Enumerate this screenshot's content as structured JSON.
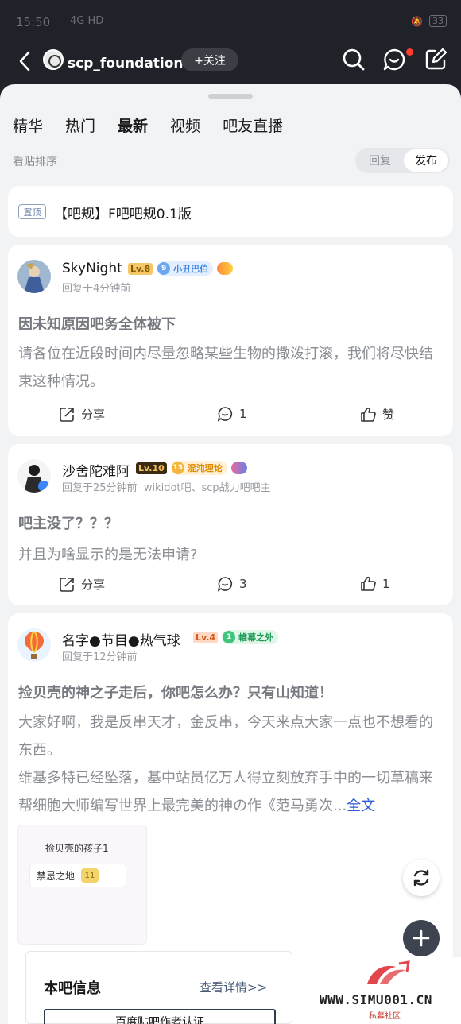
{
  "status": {
    "time": "15:50",
    "network": "4G HD",
    "battery": "33"
  },
  "forum": {
    "name": "scp_foundation吧",
    "follow_label": "+关注"
  },
  "tabs": [
    {
      "label": "精华",
      "active": false
    },
    {
      "label": "热门",
      "active": false
    },
    {
      "label": "最新",
      "active": true
    },
    {
      "label": "视频",
      "active": false
    },
    {
      "label": "吧友直播",
      "active": false
    }
  ],
  "sort": {
    "label": "看贴排序",
    "reply": "回复",
    "publish": "发布",
    "selected": "发布"
  },
  "pinned": {
    "badge": "置顶",
    "title": "【吧规】F吧吧规0.1版"
  },
  "posts": [
    {
      "username": "SkyNight",
      "level": "Lv.8",
      "fan_level": "9",
      "fan_title": "小丑巴伯",
      "meta": "回复于4分钟前",
      "title": "因未知原因吧务全体被下",
      "body": "请各位在近段时间内尽量忽略某些生物的撒泼打滚，我们将尽快结束这种情况。",
      "share_label": "分享",
      "comments": "1",
      "likes": "赞"
    },
    {
      "username": "沙舍陀难阿",
      "level": "Lv.10",
      "fan_level": "13",
      "fan_title": "混沌理论",
      "meta": "回复于25分钟前",
      "meta_extra": "wikidot吧、scp战力吧吧主",
      "title": "吧主没了？？？",
      "body": "并且为啥显示的是无法申请?",
      "share_label": "分享",
      "comments": "3",
      "likes": "1"
    },
    {
      "username": "名字●节目●热气球",
      "level": "Lv.4",
      "fan_level": "1",
      "fan_title": "帷幕之外",
      "meta": "回复于12分钟前",
      "title": "捡贝壳的神之子走后，你吧怎么办？只有山知道！",
      "body_line1": "大家好啊，我是反串天才，金反串，今天来点大家一点也不想看的东西。",
      "body_line2": "维基多特已经坠落，基中站员亿万人得立刻放弃手中的一切草稿来帮细胞大师编写世界上最完美的神の作《范马勇次...",
      "more": "全文",
      "thumb_title": "捡贝壳的孩子1",
      "thumb_chip": "禁忌之地",
      "thumb_chip_level": "11"
    }
  ],
  "forum_info": {
    "heading": "本吧信息",
    "detail_link": "查看详情>>",
    "cert_label": "百度贴吧作者认证"
  },
  "watermark": {
    "site": "WWW.SIMU001.CN",
    "cn": "私募社区"
  },
  "icons": [
    "back-icon",
    "search-icon",
    "message-icon",
    "edit-icon",
    "share-icon",
    "comment-icon",
    "like-icon",
    "refresh-icon",
    "plus-icon"
  ],
  "colors": {
    "header_bg": "#1f2229",
    "sheet_bg": "#f2f3f5",
    "link": "#2b5bd9",
    "notify": "#ff3b30"
  }
}
